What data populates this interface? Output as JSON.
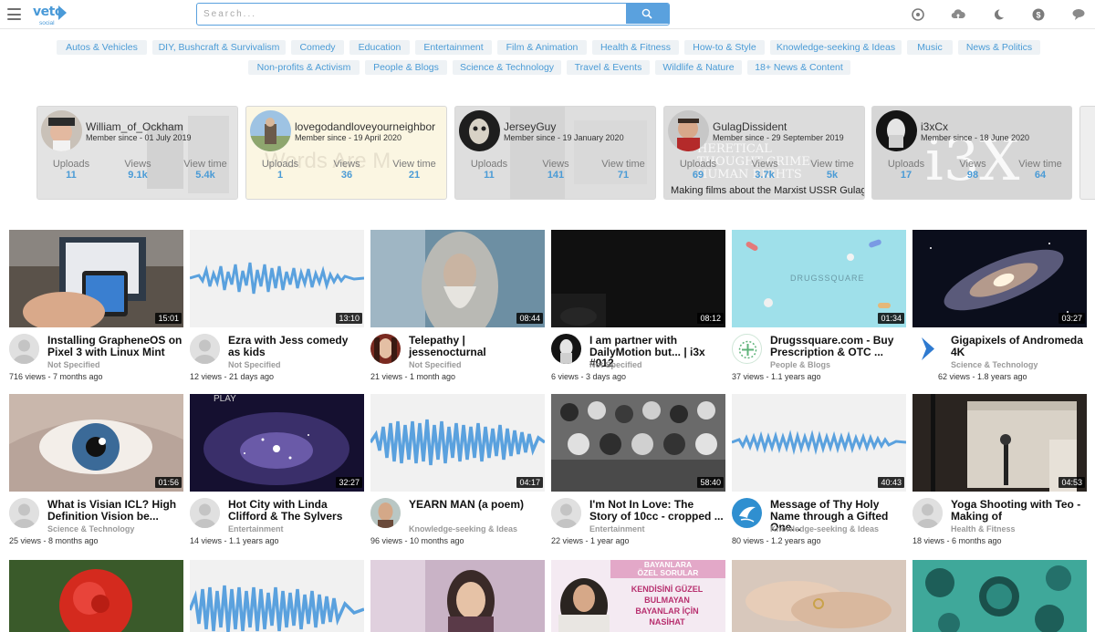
{
  "logo": {
    "text": "veto",
    "sub": "social"
  },
  "search": {
    "placeholder": "Search..."
  },
  "categories": [
    "Autos & Vehicles",
    "DIY, Bushcraft & Survivalism",
    "Comedy",
    "Education",
    "Entertainment",
    "Film & Animation",
    "Health & Fitness",
    "How-to & Style",
    "Knowledge-seeking & Ideas",
    "Music",
    "News & Politics",
    "Non-profits & Activism",
    "People & Blogs",
    "Science & Technology",
    "Travel & Events",
    "Wildlife & Nature",
    "18+ News & Content"
  ],
  "stat_labels": {
    "uploads": "Uploads",
    "views": "Views",
    "watch": "View time"
  },
  "channels": [
    {
      "name": "William_of_Ockham",
      "since": "Member since - 01 July 2019",
      "uploads": "11",
      "views": "9.1k",
      "watch": "5.4k"
    },
    {
      "name": "lovegodandloveyourneighbor",
      "since": "Member since - 19 April 2020",
      "uploads": "1",
      "views": "36",
      "watch": "21"
    },
    {
      "name": "JerseyGuy",
      "since": "Member since - 19 January 2020",
      "uploads": "11",
      "views": "141",
      "watch": "71"
    },
    {
      "name": "GulagDissident",
      "since": "Member since - 29 September 2019",
      "uploads": "69",
      "views": "3.7k",
      "watch": "5k",
      "bio": "Making films about the Marxist USSR Gulag"
    },
    {
      "name": "i3xCx",
      "since": "Member since - 18 June 2020",
      "uploads": "17",
      "views": "98",
      "watch": "64"
    }
  ],
  "videos": [
    {
      "title": "Installing GrapheneOS on Pixel 3 with Linux Mint",
      "category": "Not Specified",
      "meta": "716 views - 7 months ago",
      "duration": "15:01"
    },
    {
      "title": "Ezra with Jess comedy as kids",
      "category": "Not Specified",
      "meta": "12 views - 21 days ago",
      "duration": "13:10"
    },
    {
      "title": "Telepathy | jessenocturnal",
      "category": "Not Specified",
      "meta": "21 views - 1 month ago",
      "duration": "08:44"
    },
    {
      "title": "I am partner with DailyMotion but... | i3x #012",
      "category": "Not Specified",
      "meta": "6 views - 3 days ago",
      "duration": "08:12"
    },
    {
      "title": "Drugssquare.com - Buy Prescription & OTC ...",
      "category": "People & Blogs",
      "meta": "37 views - 1.1 years ago",
      "duration": "01:34"
    },
    {
      "title": "Gigapixels of Andromeda 4K",
      "category": "Science & Technology",
      "meta": "62 views - 1.8 years ago",
      "duration": "03:27"
    },
    {
      "title": "What is Visian ICL? High Definition Vision be...",
      "category": "Science & Technology",
      "meta": "25 views - 8 months ago",
      "duration": "01:56"
    },
    {
      "title": "Hot City with Linda Clifford & The Sylvers",
      "category": "Entertainment",
      "meta": "14 views - 1.1 years ago",
      "duration": "32:27"
    },
    {
      "title": "YEARN MAN (a poem)",
      "category": "Knowledge-seeking & Ideas",
      "meta": "96 views - 10 months ago",
      "duration": "04:17"
    },
    {
      "title": "I'm Not In Love: The Story of 10cc - cropped ...",
      "category": "Entertainment",
      "meta": "22 views - 1 year ago",
      "duration": "58:40"
    },
    {
      "title": "Message of Thy Holy Name through a Gifted One...",
      "category": "Knowledge-seeking & Ideas",
      "meta": "80 views - 1.2 years ago",
      "duration": "40:43"
    },
    {
      "title": "Yoga Shooting with Teo - Making of",
      "category": "Health & Fitness",
      "meta": "18 views - 6 months ago",
      "duration": "04:53"
    }
  ],
  "thumb_text": {
    "drugs": "DRUGSSQUARE",
    "play": "PLAY",
    "ozel_title": [
      "BAYANLARA",
      "ÖZEL SORULAR"
    ],
    "ozel_lines": [
      "KENDİSİNİ GÜZEL",
      "BULMAYAN",
      "BAYANLAR İÇİN",
      "NASİHAT"
    ],
    "i3x_wm": "i3X",
    "gulag_wm": "HERETICAL THOUGHT CRIME HUMAN RIGHTS",
    "love_wm": "Words Are M"
  },
  "colors": {
    "accent": "#4a9bd6",
    "chip_bg": "#eef2f5",
    "wave": "#5aa1de"
  }
}
